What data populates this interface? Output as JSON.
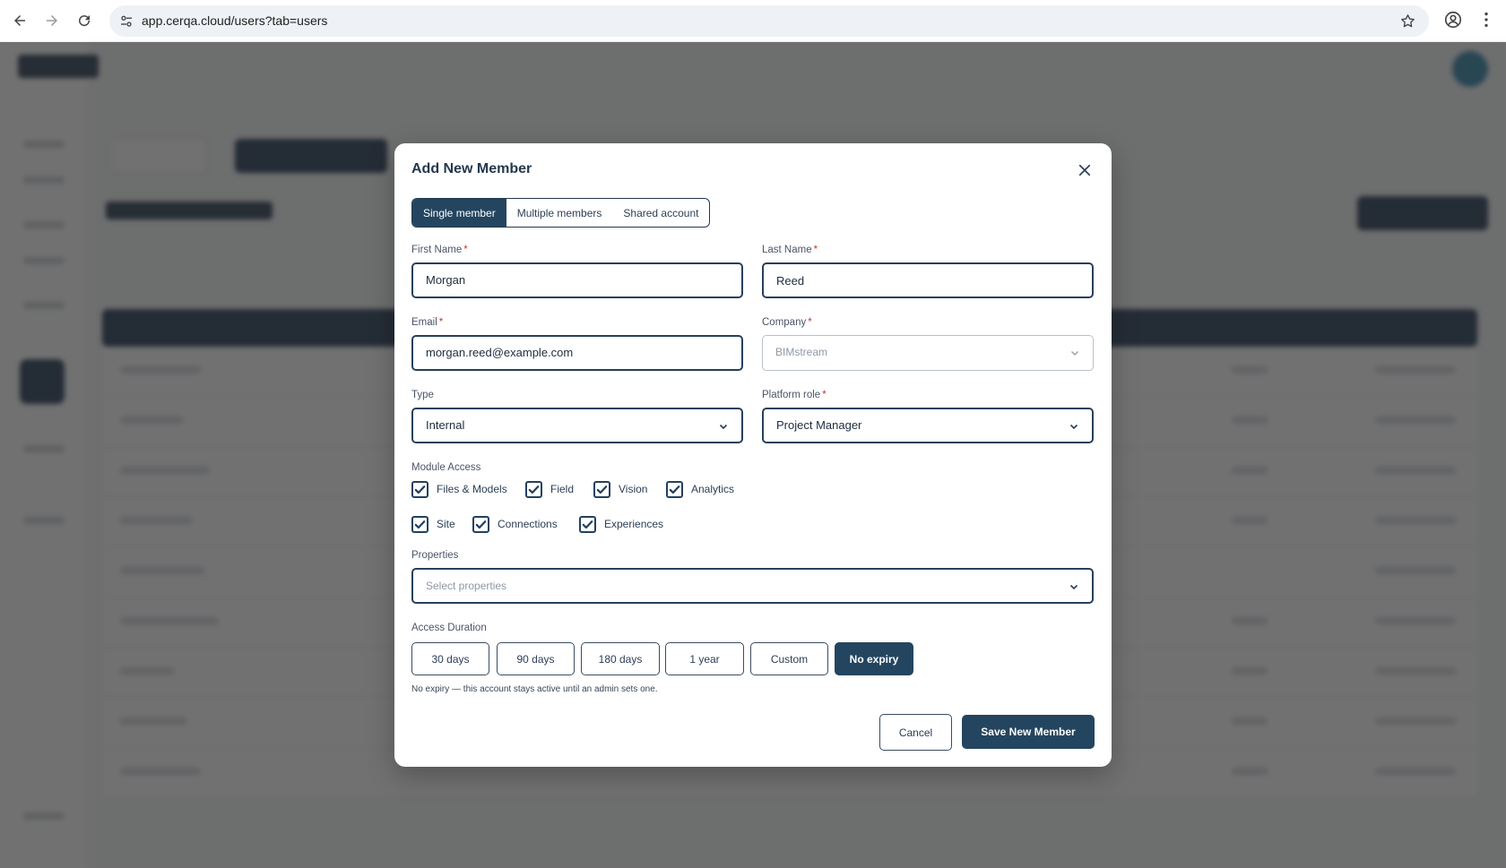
{
  "browser": {
    "url": "app.cerqa.cloud/users?tab=users"
  },
  "modal": {
    "title": "Add New Member",
    "tabs": [
      {
        "label": "Single member",
        "active": true
      },
      {
        "label": "Multiple members",
        "active": false
      },
      {
        "label": "Shared account",
        "active": false
      }
    ],
    "fields": {
      "first_name": {
        "label": "First Name",
        "required": "*",
        "value": "Morgan"
      },
      "last_name": {
        "label": "Last Name",
        "required": "*",
        "value": "Reed"
      },
      "email": {
        "label": "Email",
        "required": "*",
        "value": "morgan.reed@example.com"
      },
      "company": {
        "label": "Company",
        "required": "*",
        "value": "BIMstream"
      },
      "type": {
        "label": "Type",
        "value": "Internal"
      },
      "platform_role": {
        "label": "Platform role",
        "required": "*",
        "value": "Project Manager"
      }
    },
    "module_access": {
      "label": "Module Access",
      "items": [
        {
          "label": "Files & Models",
          "checked": true
        },
        {
          "label": "Field",
          "checked": true
        },
        {
          "label": "Vision",
          "checked": true
        },
        {
          "label": "Analytics",
          "checked": true
        },
        {
          "label": "Site",
          "checked": true
        },
        {
          "label": "Connections",
          "checked": true
        },
        {
          "label": "Experiences",
          "checked": true
        }
      ]
    },
    "properties": {
      "label": "Properties",
      "placeholder": "Select properties"
    },
    "access_duration": {
      "label": "Access Duration",
      "options": [
        {
          "label": "30 days",
          "active": false
        },
        {
          "label": "90 days",
          "active": false
        },
        {
          "label": "180 days",
          "active": false
        },
        {
          "label": "1 year",
          "active": false
        },
        {
          "label": "Custom",
          "active": false
        },
        {
          "label": "No expiry",
          "active": true
        }
      ],
      "note": "No expiry — this account stays active until an admin sets one."
    },
    "actions": {
      "cancel": "Cancel",
      "save": "Save New Member"
    }
  },
  "colors": {
    "primary": "#24455f",
    "required": "#c0392b",
    "overlay": "#3a3a3a"
  }
}
